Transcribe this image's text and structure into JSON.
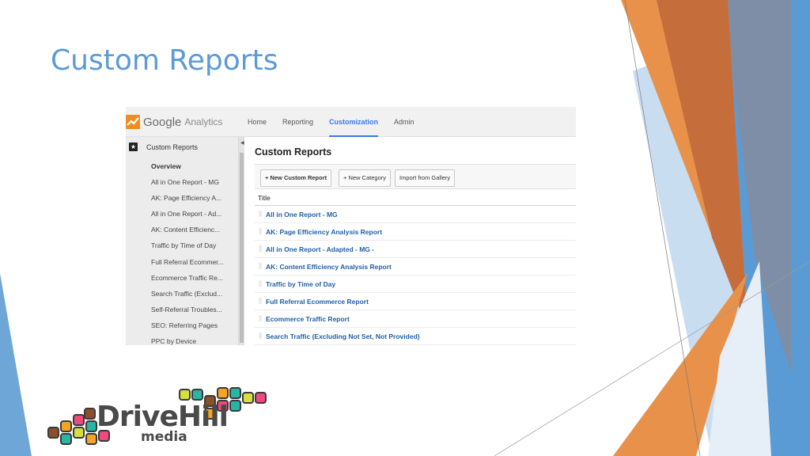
{
  "slide": {
    "title": "Custom Reports"
  },
  "colors": {
    "title": "#5b9bd5",
    "orange": "#e8914a",
    "orange_dark": "#c9683d",
    "blue": "#5b9bd5",
    "blue_light": "#bdd7ee",
    "slate": "#7a8aa0",
    "ga_link": "#1f5fa6",
    "ga_active": "#3b78e7"
  },
  "ga": {
    "logo_text": "Google",
    "logo_sub": "Analytics",
    "nav": [
      {
        "label": "Home",
        "active": false
      },
      {
        "label": "Reporting",
        "active": false
      },
      {
        "label": "Customization",
        "active": true
      },
      {
        "label": "Admin",
        "active": false
      }
    ],
    "sidebar": {
      "header": "Custom Reports",
      "items": [
        "Overview",
        "All in One Report - MG",
        "AK: Page Efficiency A...",
        "All in One Report - Ad...",
        "AK: Content Efficienc...",
        "Traffic by Time of Day",
        "Full Referral Ecommer...",
        "Ecommerce Traffic Re...",
        "Search Traffic (Exclud...",
        "Self-Referral Troubles...",
        "SEO: Referring Pages",
        "PPC by Device"
      ]
    },
    "main": {
      "title": "Custom Reports",
      "buttons": {
        "new_report": "+ New Custom Report",
        "new_category": "+ New Category",
        "import": "Import from Gallery"
      },
      "column_title": "Title",
      "rows": [
        "All in One Report - MG",
        "AK: Page Efficiency Analysis Report",
        "All in One Report - Adapted - MG -",
        "AK: Content Efficiency Analysis Report",
        "Traffic by Time of Day",
        "Full Referral Ecommerce Report",
        "Ecommerce Traffic Report",
        "Search Traffic (Excluding Not Set, Not Provided)"
      ]
    }
  },
  "logo": {
    "word": "DriveHill",
    "sub": "media",
    "tile_colors": [
      "#ef4a7d",
      "#f6a423",
      "#2bb3a4",
      "#d7de3e",
      "#8b4f2a",
      "#4a4a4a"
    ]
  }
}
